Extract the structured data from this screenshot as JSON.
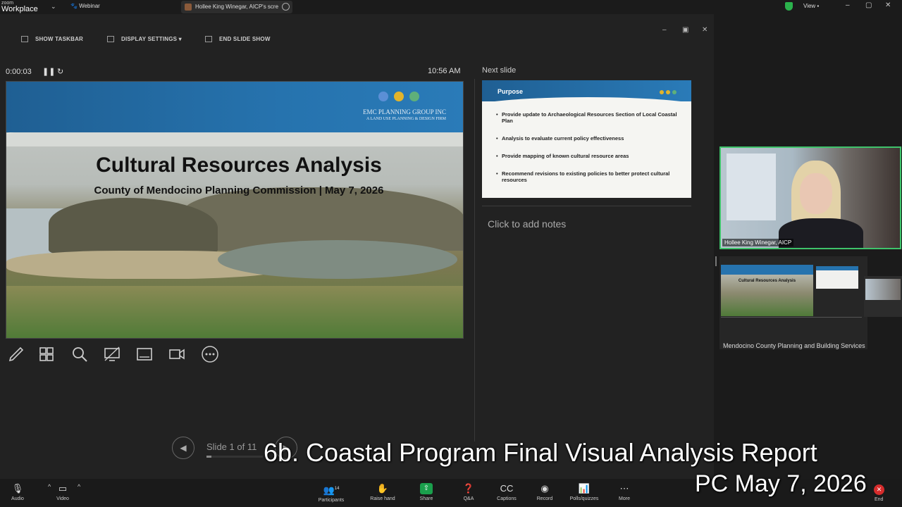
{
  "zoom": {
    "brand_top": "zoom",
    "brand_bottom": "Workplace",
    "webinar_label": "Webinar",
    "share_pill": "Hollee King Winegar, AICP's scre",
    "view_label": "View"
  },
  "presenter": {
    "toolbar": {
      "show_taskbar": "SHOW TASKBAR",
      "display_settings": "DISPLAY SETTINGS ▾",
      "end_slide_show": "END SLIDE SHOW"
    },
    "timer": "0:00:03",
    "clock": "10:56 AM",
    "current_slide": {
      "title": "Cultural Resources Analysis",
      "subtitle": "County of Mendocino Planning Commission  |  May 7, 2026",
      "logo_line1": "EMC PLANNING GROUP INC",
      "logo_line2": "A LAND USE PLANNING & DESIGN FIRM",
      "dot_colors": [
        "#5b8fd6",
        "#e2b42b",
        "#5fb07a"
      ]
    },
    "next_slide_label": "Next slide",
    "next_slide": {
      "title": "Purpose",
      "bullets": [
        "Provide update to Archaeological Resources Section of Local Coastal Plan",
        "Analysis to evaluate current policy effectiveness",
        "Provide mapping of known cultural resource areas",
        "Recommend revisions to existing policies to better protect cultural resources"
      ]
    },
    "notes_placeholder": "Click to add notes",
    "slide_counter": "Slide 1 of 11",
    "progress_fraction": 0.09
  },
  "participant": {
    "name": "Hollee King Winegar, AICP"
  },
  "share": {
    "name": "Mendocino County Planning and Building Services",
    "thumb_title": "Cultural Resources Analysis"
  },
  "bottombar": {
    "audio": "Audio",
    "video": "Video",
    "participants": "Participants",
    "participants_count": "14",
    "raise_hand": "Raise hand",
    "share": "Share",
    "qa": "Q&A",
    "captions": "Captions",
    "record": "Record",
    "polls": "Polls/quizzes",
    "more": "More",
    "end": "End"
  },
  "caption": {
    "line1": "6b. Coastal Program Final Visual Analysis Report",
    "line2": "PC May 7, 2026"
  }
}
